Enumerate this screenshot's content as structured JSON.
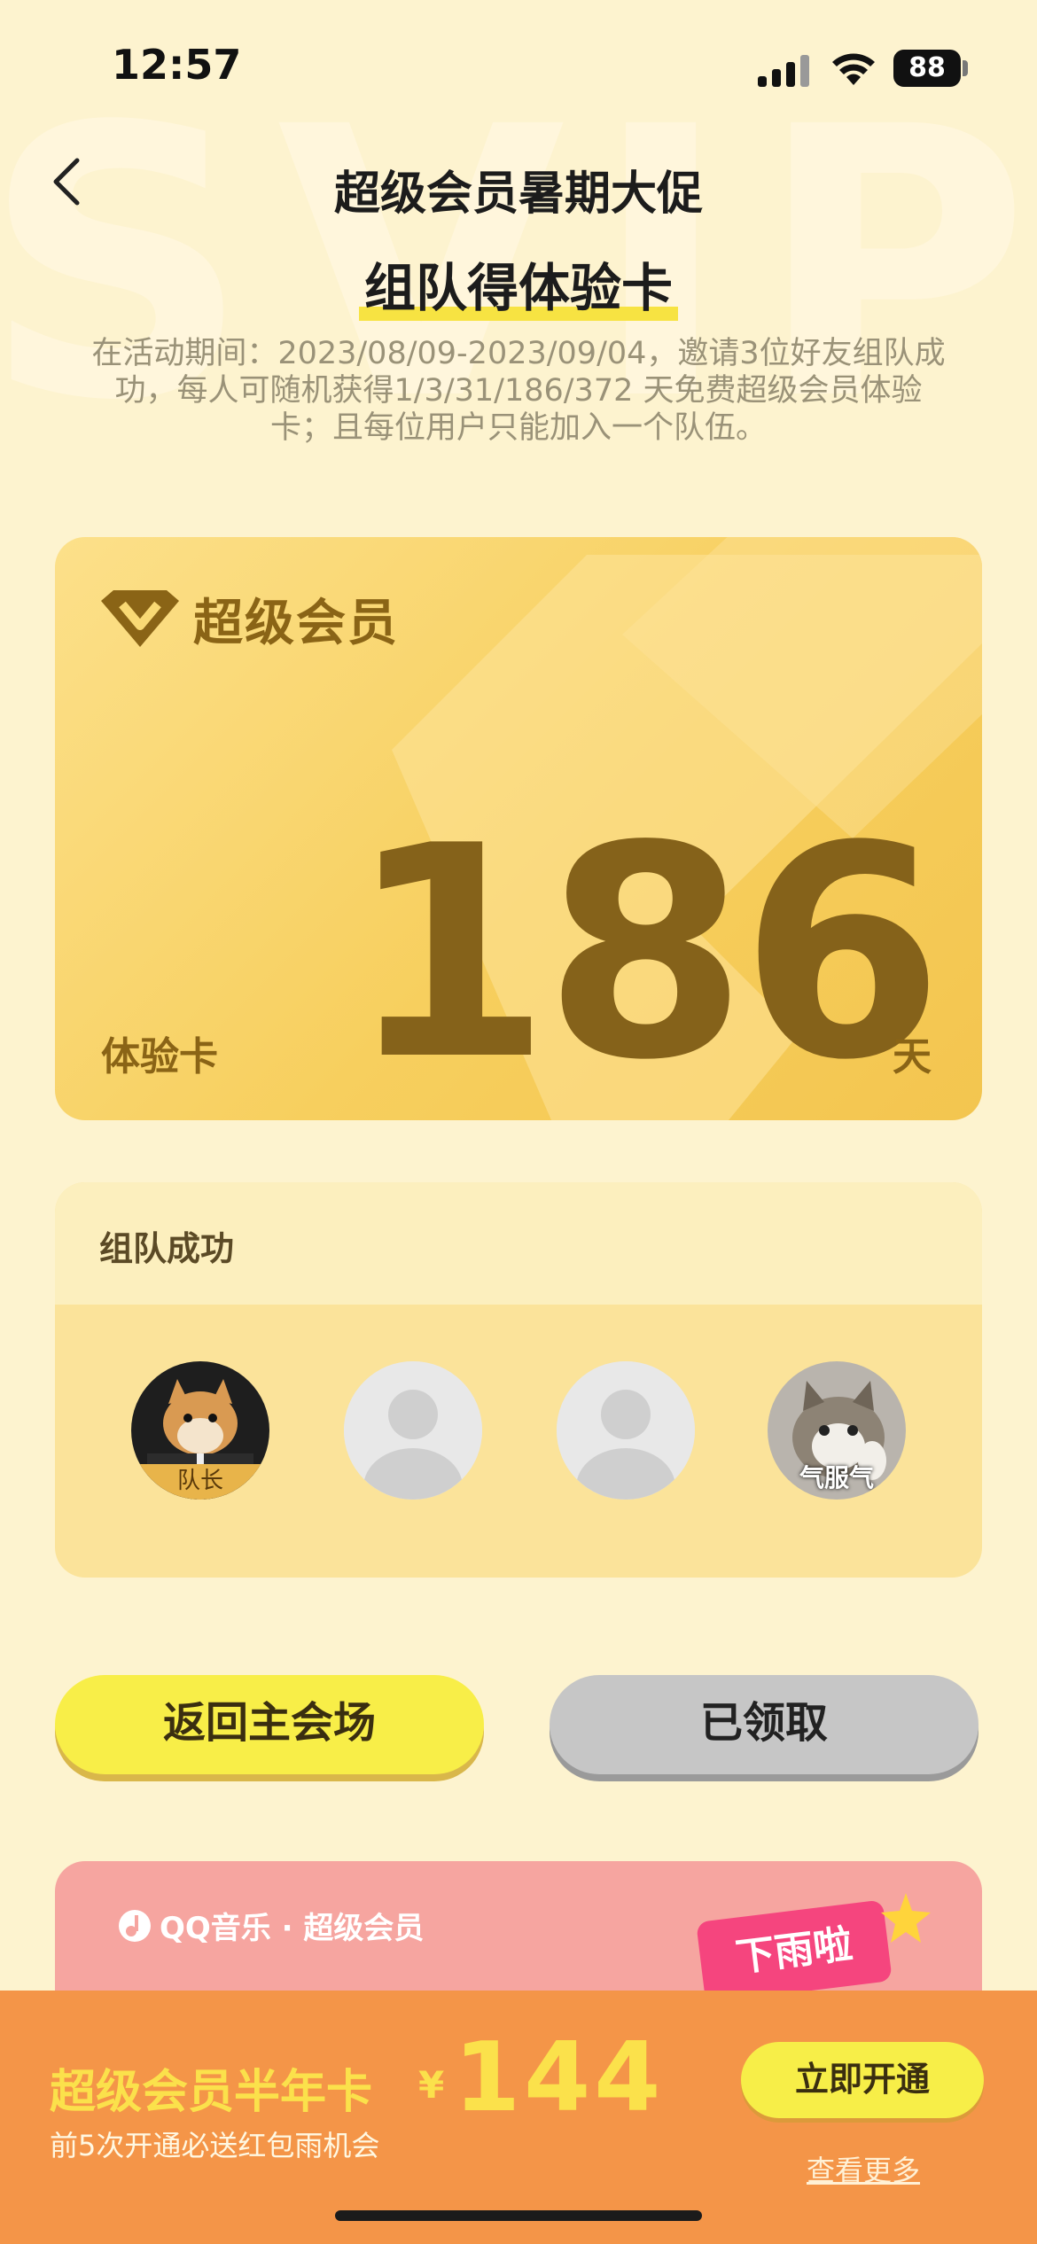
{
  "status_bar": {
    "time": "12:57",
    "battery": "88"
  },
  "nav": {
    "title": "超级会员暑期大促"
  },
  "subtitle": "组队得体验卡",
  "description": "在活动期间：2023/08/09-2023/09/04，邀请3位好友组队成功，每人可随机获得1/3/31/186/372 天免费超级会员体验卡；且每位用户只能加入一个队伍。",
  "card": {
    "brand": "超级会员",
    "label": "体验卡",
    "days": "186",
    "unit": "天"
  },
  "team": {
    "title": "组队成功",
    "leader_tag": "队长",
    "member_caption": "气服气"
  },
  "buttons": {
    "return": "返回主会场",
    "claimed": "已领取"
  },
  "promo": {
    "brand": "QQ音乐 · 超级会员",
    "sticker": "下雨啦"
  },
  "bottom_bar": {
    "title": "超级会员半年卡",
    "currency": "¥",
    "price": "144",
    "subtitle": "前5次开通必送红包雨机会",
    "open_button": "立即开通",
    "more_link": "查看更多"
  },
  "colors": {
    "background": "#fdf3cf",
    "gold_text": "#85621a",
    "yellow_button": "#f8ee48",
    "bottom_bar": "#f49548"
  }
}
